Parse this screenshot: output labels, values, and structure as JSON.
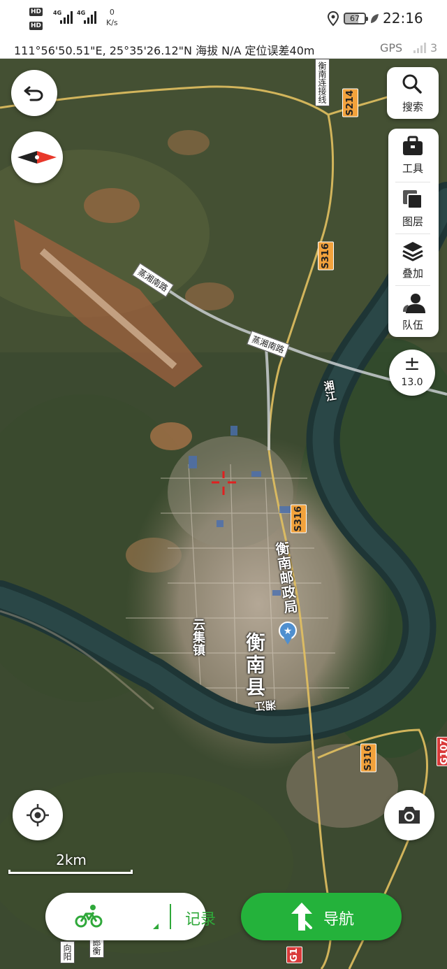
{
  "status_bar": {
    "hd_badge_1": "HD",
    "hd_badge_2": "HD",
    "network_1": "4G",
    "network_2": "4G",
    "speed_value": "0",
    "speed_unit": "K/s",
    "battery_level": "67",
    "time": "22:16"
  },
  "info_bar": {
    "coordinates": "111°56'50.51\"E, 25°35'26.12\"N  海拔 N/A  定位误差40m",
    "gps_label": "GPS",
    "gps_count": "3"
  },
  "map": {
    "labels": {
      "river_xiang_1": "湘江",
      "river_xiang_2": "湘江",
      "county": "衡南县",
      "town": "云集镇",
      "post_office": "衡南邮政局",
      "road_zhengxiang_1": "蒸湘南路",
      "road_zhengxiang_2": "蒸湘南路",
      "road_hengnan_link": "衡南连接线",
      "road_s214": "S214",
      "road_s316_1": "S316",
      "road_s316_2": "S316",
      "road_s316_3": "S316",
      "road_g107": "G107",
      "road_g1_partial": "G1",
      "bottom_road_1": "向阳",
      "bottom_road_2": "郎衡"
    }
  },
  "toolbar": {
    "search_label": "搜索",
    "tools_label": "工具",
    "layers_label": "图层",
    "overlay_label": "叠加",
    "team_label": "队伍"
  },
  "zoom": {
    "symbol": "±",
    "level": "13.0"
  },
  "scale_bar": {
    "label": "2km"
  },
  "bottom": {
    "record_label": "记录",
    "navigate_label": "导航"
  },
  "colors": {
    "accent_green": "#24b23b",
    "record_green": "#2fa83a",
    "road_tag_orange": "#f2a23c",
    "compass_red": "#e8382b",
    "crosshair_red": "#e02020"
  }
}
